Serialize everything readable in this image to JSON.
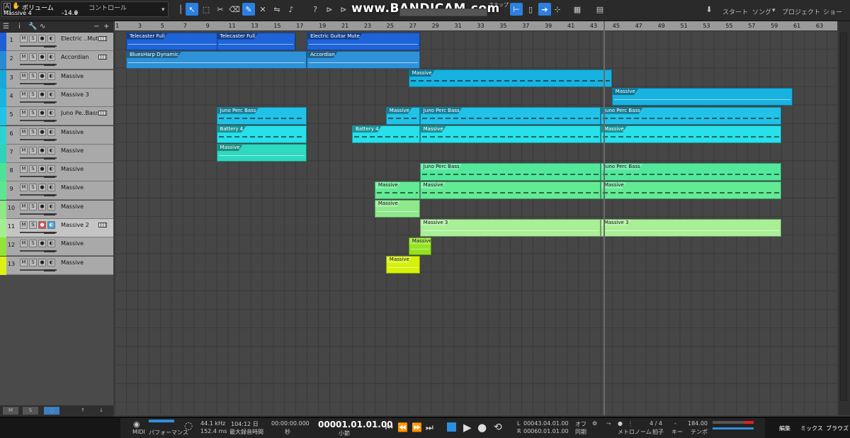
{
  "toolbar": {
    "volume_label": "ボリューム",
    "control_label": "コントロール",
    "track_name": "Massive 4",
    "volume_value": "-14.0",
    "bandicam": "www.BANDICAM.com",
    "snap_label": "スナップ",
    "start_label": "スタート",
    "song_label": "ソング",
    "project_label": "プロジェクト",
    "show_label": "ショー"
  },
  "tracks": [
    {
      "num": "1",
      "name": "Electric ..Mute",
      "color": "#1f5fd6",
      "instrument": true
    },
    {
      "num": "2",
      "name": "Accordian",
      "color": "#2a8ad6",
      "instrument": true
    },
    {
      "num": "3",
      "name": "Massive",
      "color": "#16a9d8",
      "instrument": false
    },
    {
      "num": "4",
      "name": "Massive 3",
      "color": "#1bb4df",
      "instrument": false
    },
    {
      "num": "5",
      "name": "Juno Pe..Bass",
      "color": "#21c3e6",
      "instrument": true
    },
    {
      "num": "6",
      "name": "Massive",
      "color": "#2bd3d3",
      "instrument": false
    },
    {
      "num": "7",
      "name": "Massive",
      "color": "#2fd3b8",
      "instrument": false
    },
    {
      "num": "8",
      "name": "Massive",
      "color": "#4fe09a",
      "instrument": false
    },
    {
      "num": "9",
      "name": "Massive",
      "color": "#5fe590",
      "instrument": false
    },
    {
      "num": "10",
      "name": "Massive",
      "color": "#8de88a",
      "instrument": false
    },
    {
      "num": "11",
      "name": "Massive 2",
      "color": "#a3ee8e",
      "instrument": true
    },
    {
      "num": "12",
      "name": "Massive",
      "color": "#92e23a",
      "instrument": false
    },
    {
      "num": "13",
      "name": "Massive",
      "color": "#dcf016",
      "instrument": false
    }
  ],
  "ruler": [
    "1",
    "3",
    "5",
    "7",
    "9",
    "11",
    "13",
    "15",
    "17",
    "19",
    "21",
    "23",
    "25",
    "27",
    "29",
    "31",
    "33",
    "35",
    "37",
    "39",
    "41",
    "43",
    "45",
    "47",
    "49",
    "51",
    "53",
    "55",
    "57",
    "59",
    "61",
    "63"
  ],
  "clips": [
    {
      "track": 0,
      "start": 2,
      "end": 17,
      "name": "Telecaster Full",
      "color": "#1e63d8",
      "style": "line"
    },
    {
      "track": 0,
      "start": 10,
      "end": 17,
      "name": "Telecaster Full",
      "color": "#1e63d8",
      "style": "line"
    },
    {
      "track": 0,
      "start": 18,
      "end": 28,
      "name": "Electric Guitar Mute",
      "color": "#1e63d8",
      "style": "line"
    },
    {
      "track": 1,
      "start": 2,
      "end": 18,
      "name": "BluesHarp Dynamic",
      "color": "#2f92d8",
      "style": "line"
    },
    {
      "track": 1,
      "start": 18,
      "end": 28,
      "name": "Accordian",
      "color": "#2f92d8",
      "style": "line"
    },
    {
      "track": 2,
      "start": 27,
      "end": 45,
      "name": "Massive",
      "color": "#17b2e0",
      "style": "dash"
    },
    {
      "track": 3,
      "start": 45,
      "end": 61,
      "name": "Massive",
      "color": "#17b2e0",
      "style": "line"
    },
    {
      "track": 4,
      "start": 10,
      "end": 18,
      "name": "Juno Perc Bass",
      "color": "#22c2e8",
      "style": "dash"
    },
    {
      "track": 4,
      "start": 25,
      "end": 28,
      "name": "Massive",
      "color": "#22c2e8",
      "style": "dash"
    },
    {
      "track": 4,
      "start": 28,
      "end": 44,
      "name": "Juno Perc Bass",
      "color": "#22c2e8",
      "style": "dash"
    },
    {
      "track": 4,
      "start": 44,
      "end": 60,
      "name": "Juno Perc Bass",
      "color": "#22c2e8",
      "style": "dash"
    },
    {
      "track": 5,
      "start": 10,
      "end": 18,
      "name": "Battery 4",
      "color": "#27e0ea",
      "style": "dash"
    },
    {
      "track": 5,
      "start": 22,
      "end": 28,
      "name": "Battery 4",
      "color": "#27e0ea",
      "style": "dash"
    },
    {
      "track": 5,
      "start": 28,
      "end": 44,
      "name": "Massive",
      "color": "#27e0ea",
      "style": "dash"
    },
    {
      "track": 5,
      "start": 44,
      "end": 60,
      "name": "Massive",
      "color": "#27e0ea",
      "style": "dash"
    },
    {
      "track": 6,
      "start": 10,
      "end": 18,
      "name": "Massive",
      "color": "#2ed9c0",
      "style": "line"
    },
    {
      "track": 7,
      "start": 28,
      "end": 44,
      "name": "Juno Perc Bass",
      "color": "#52e89c",
      "style": "dash"
    },
    {
      "track": 7,
      "start": 44,
      "end": 60,
      "name": "Juno Perc Bass",
      "color": "#52e89c",
      "style": "dash"
    },
    {
      "track": 8,
      "start": 24,
      "end": 28,
      "name": "Massive",
      "color": "#63ea95",
      "style": "dash"
    },
    {
      "track": 8,
      "start": 28,
      "end": 44,
      "name": "Massive",
      "color": "#63ea95",
      "style": "dash"
    },
    {
      "track": 8,
      "start": 44,
      "end": 60,
      "name": "Massive",
      "color": "#63ea95",
      "style": "dash"
    },
    {
      "track": 9,
      "start": 24,
      "end": 28,
      "name": "Massive",
      "color": "#8ee98c",
      "style": "line"
    },
    {
      "track": 10,
      "start": 28,
      "end": 44,
      "name": "Massive 3",
      "color": "#a8ef96",
      "style": "line"
    },
    {
      "track": 10,
      "start": 44,
      "end": 60,
      "name": "Massive 3",
      "color": "#a8ef96",
      "style": "line"
    },
    {
      "track": 11,
      "start": 27,
      "end": 29,
      "name": "Massive",
      "color": "#93e31f",
      "style": "line"
    },
    {
      "track": 12,
      "start": 25,
      "end": 28,
      "name": "Massive",
      "color": "#d6f20a",
      "style": "line"
    }
  ],
  "transport": {
    "midi": "MIDI",
    "performance": "パフォーマンス",
    "sample_rate": "44.1 kHz",
    "latency": "152.4 ms",
    "record_time": "104:12 日",
    "record_time_label": "最大録音時間",
    "seconds": "00:00:00.000",
    "seconds_label": "秒",
    "bars": "00001.01.01.00",
    "bars_label": "小節",
    "loop_left": "00043.04.01.00",
    "loop_right": "00060.01.01.00",
    "loop_l_tag": "L",
    "loop_r_tag": "R",
    "off": "オフ",
    "sync": "同期",
    "metronome": "メトロノーム",
    "signature": "4 / 4",
    "signature_label": "拍子",
    "key": "-",
    "key_label": "キー",
    "tempo": "184.00",
    "tempo_label": "テンポ",
    "edit": "編集",
    "mix": "ミックス",
    "browse": "ブラウズ"
  },
  "footer_buttons": [
    "M",
    "S"
  ]
}
